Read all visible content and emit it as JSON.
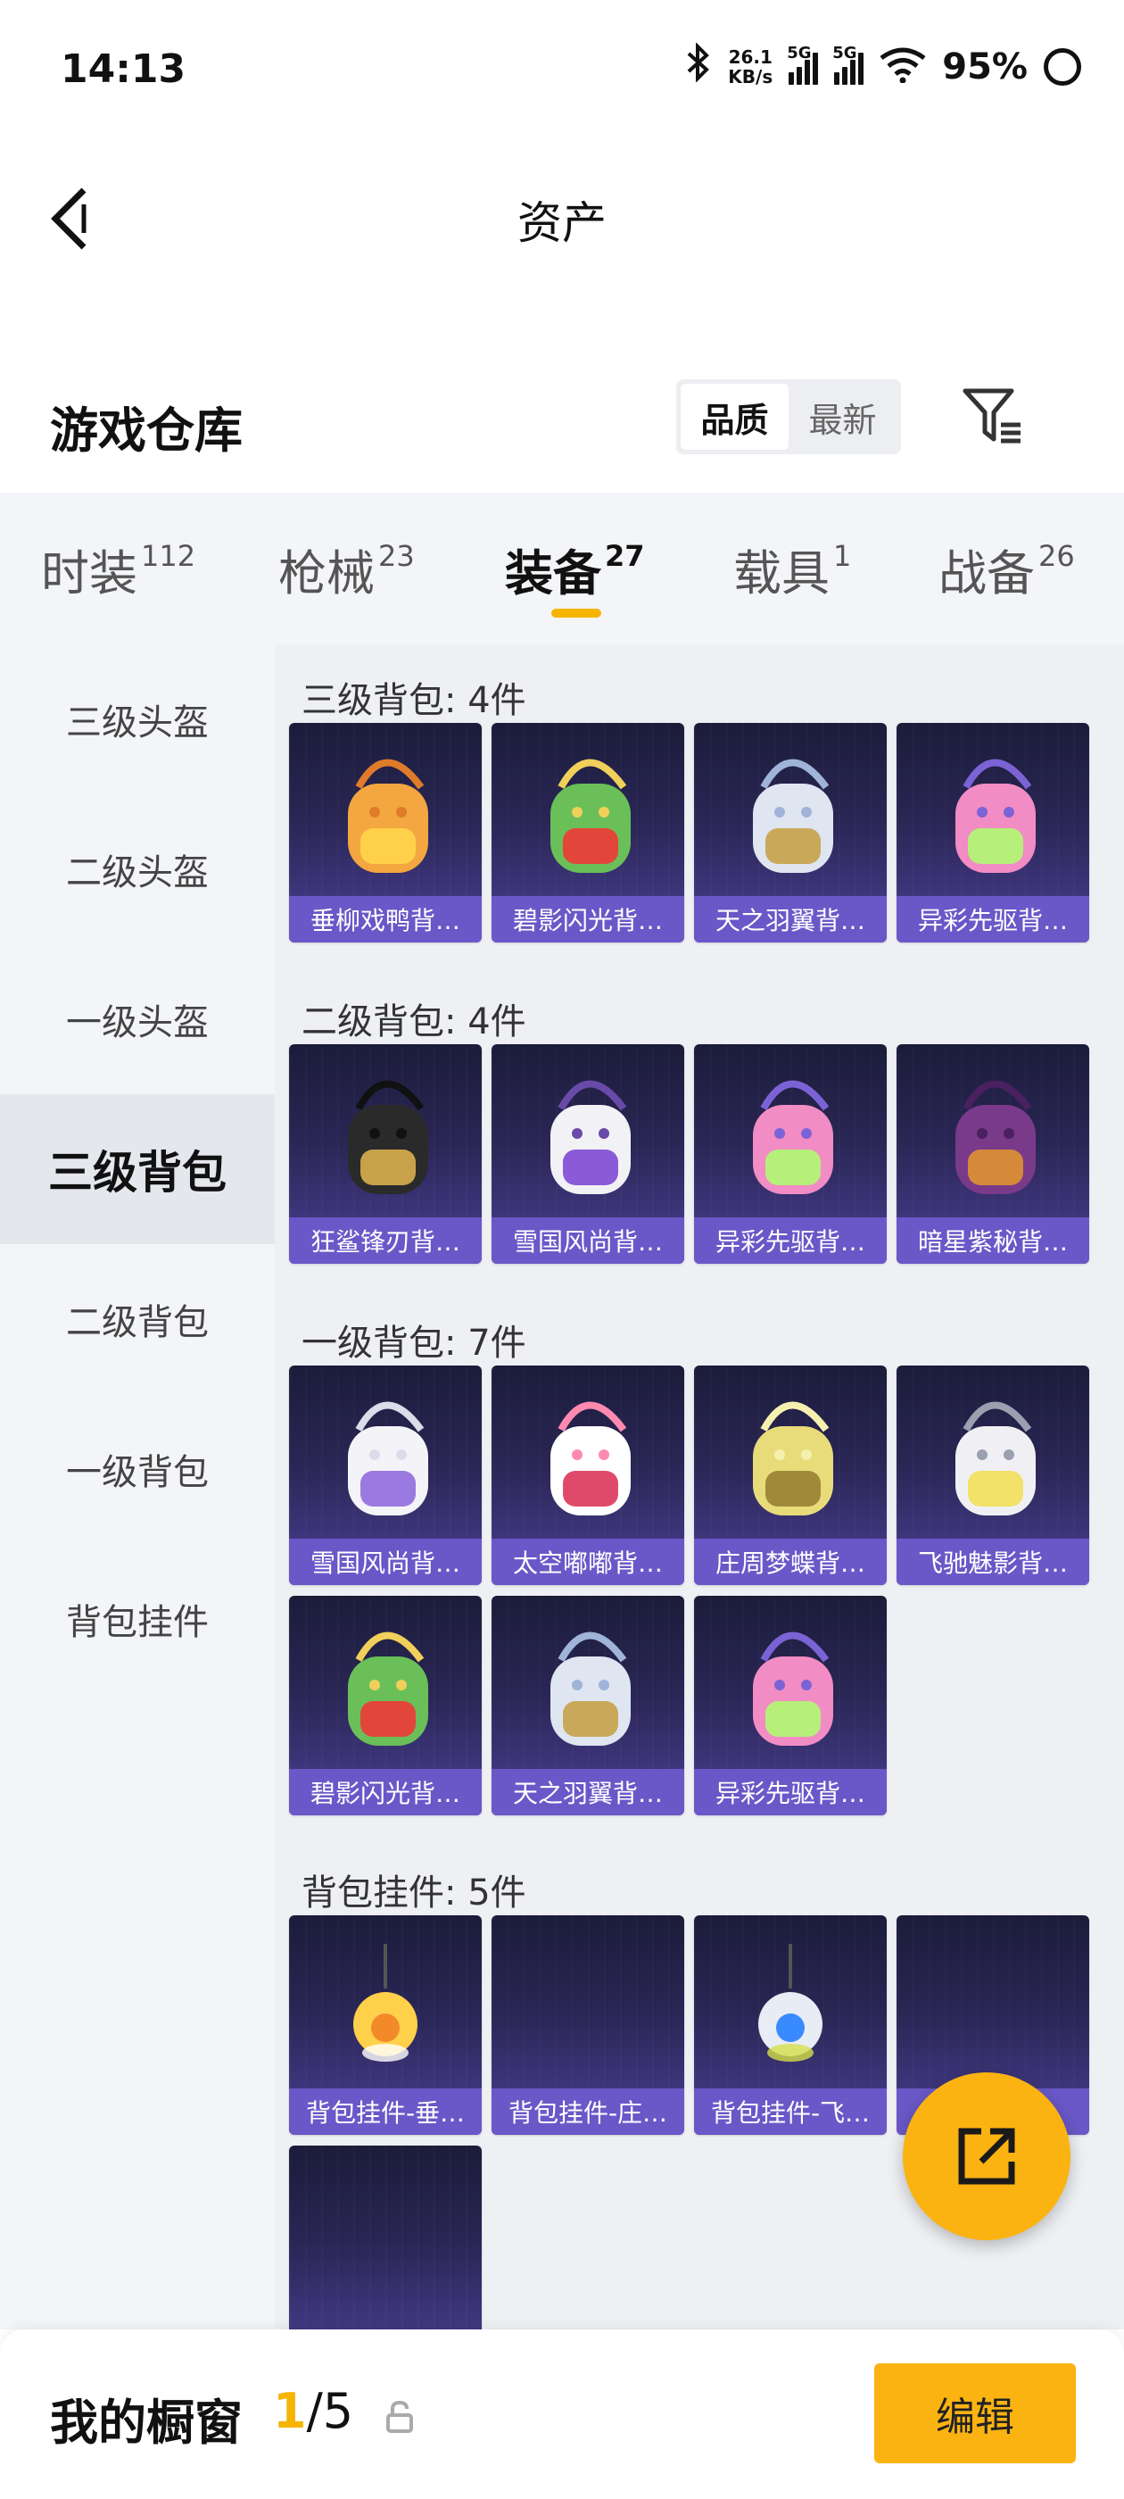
{
  "status_bar": {
    "time": "14:13",
    "net_speed_value": "26.1",
    "net_speed_unit": "KB/s",
    "signal1_label": "5G",
    "signal2_label": "5G",
    "battery": "95%"
  },
  "header": {
    "title": "资产"
  },
  "warehouse": {
    "title": "游戏仓库",
    "sort_options": [
      "品质",
      "最新"
    ],
    "sort_active": "品质"
  },
  "tabs": [
    {
      "label": "时装",
      "count": "112"
    },
    {
      "label": "枪械",
      "count": "23"
    },
    {
      "label": "装备",
      "count": "27",
      "active": true
    },
    {
      "label": "载具",
      "count": "1"
    },
    {
      "label": "战备",
      "count": "26"
    }
  ],
  "sidebar": {
    "items": [
      "三级头盔",
      "二级头盔",
      "一级头盔",
      "三级背包",
      "二级背包",
      "一级背包",
      "背包挂件"
    ],
    "active": "三级背包"
  },
  "groups": [
    {
      "title": "三级背包: 4件",
      "items": [
        {
          "name": "垂柳戏鸭背…",
          "icon": "duck-backpack-icon"
        },
        {
          "name": "碧影闪光背…",
          "icon": "green-backpack-icon"
        },
        {
          "name": "天之羽翼背…",
          "icon": "wing-backpack-icon"
        },
        {
          "name": "异彩先驱背…",
          "icon": "pink-backpack-icon"
        }
      ]
    },
    {
      "title": "二级背包: 4件",
      "items": [
        {
          "name": "狂鲨锋刃背…",
          "icon": "shark-backpack-icon"
        },
        {
          "name": "雪国风尚背…",
          "icon": "snowman-backpack-icon"
        },
        {
          "name": "异彩先驱背…",
          "icon": "pink-backpack-icon"
        },
        {
          "name": "暗星紫秘背…",
          "icon": "purple-backpack-icon"
        }
      ]
    },
    {
      "title": "一级背包: 7件",
      "items": [
        {
          "name": "雪国风尚背…",
          "icon": "snowball-backpack-icon"
        },
        {
          "name": "太空嘟嘟背…",
          "icon": "space-backpack-icon"
        },
        {
          "name": "庄周梦蝶背…",
          "icon": "butterfly-backpack-icon"
        },
        {
          "name": "飞驰魅影背…",
          "icon": "white-backpack-icon"
        },
        {
          "name": "碧影闪光背…",
          "icon": "green-backpack-icon"
        },
        {
          "name": "天之羽翼背…",
          "icon": "wing-backpack-icon"
        },
        {
          "name": "异彩先驱背…",
          "icon": "pink-backpack-icon"
        }
      ]
    },
    {
      "title": "背包挂件: 5件",
      "items": [
        {
          "name": "背包挂件-垂…",
          "icon": "duck-charm-icon"
        },
        {
          "name": "背包挂件-庄…",
          "icon": "empty-slot"
        },
        {
          "name": "背包挂件-飞…",
          "icon": "orb-charm-icon"
        },
        {
          "name": "…",
          "icon": "empty-slot"
        },
        {
          "name": "",
          "icon": "empty-slot"
        }
      ]
    }
  ],
  "bottom_bar": {
    "label": "我的橱窗",
    "current": "1",
    "total": "/5",
    "edit_label": "编辑"
  },
  "colors": {
    "accent": "#fbb312",
    "card_caption": "#6a58c8",
    "card_bg": "#2a2655"
  }
}
